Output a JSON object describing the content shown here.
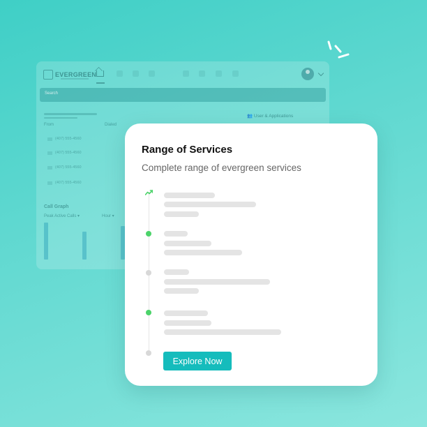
{
  "dashboard": {
    "logo": "EVERGREEN",
    "search_placeholder": "Search",
    "user_apps": "User & Applications",
    "col_from": "From",
    "col_dialed": "Dialed",
    "rows": [
      "(407) 555-4560",
      "(407) 555-4560",
      "(407) 555-4560",
      "(407) 555-4560"
    ],
    "graph_title": "Call Graph",
    "filter_left": "Peak Active Calls ▾",
    "filter_right": "Hour ▾"
  },
  "card": {
    "title": "Range of Services",
    "subtitle": "Complete range of evergreen services",
    "button": "Explore Now"
  },
  "colors": {
    "accent": "#15bcbc",
    "status_active": "#4cd36a",
    "status_inactive": "#d8d8d8"
  }
}
